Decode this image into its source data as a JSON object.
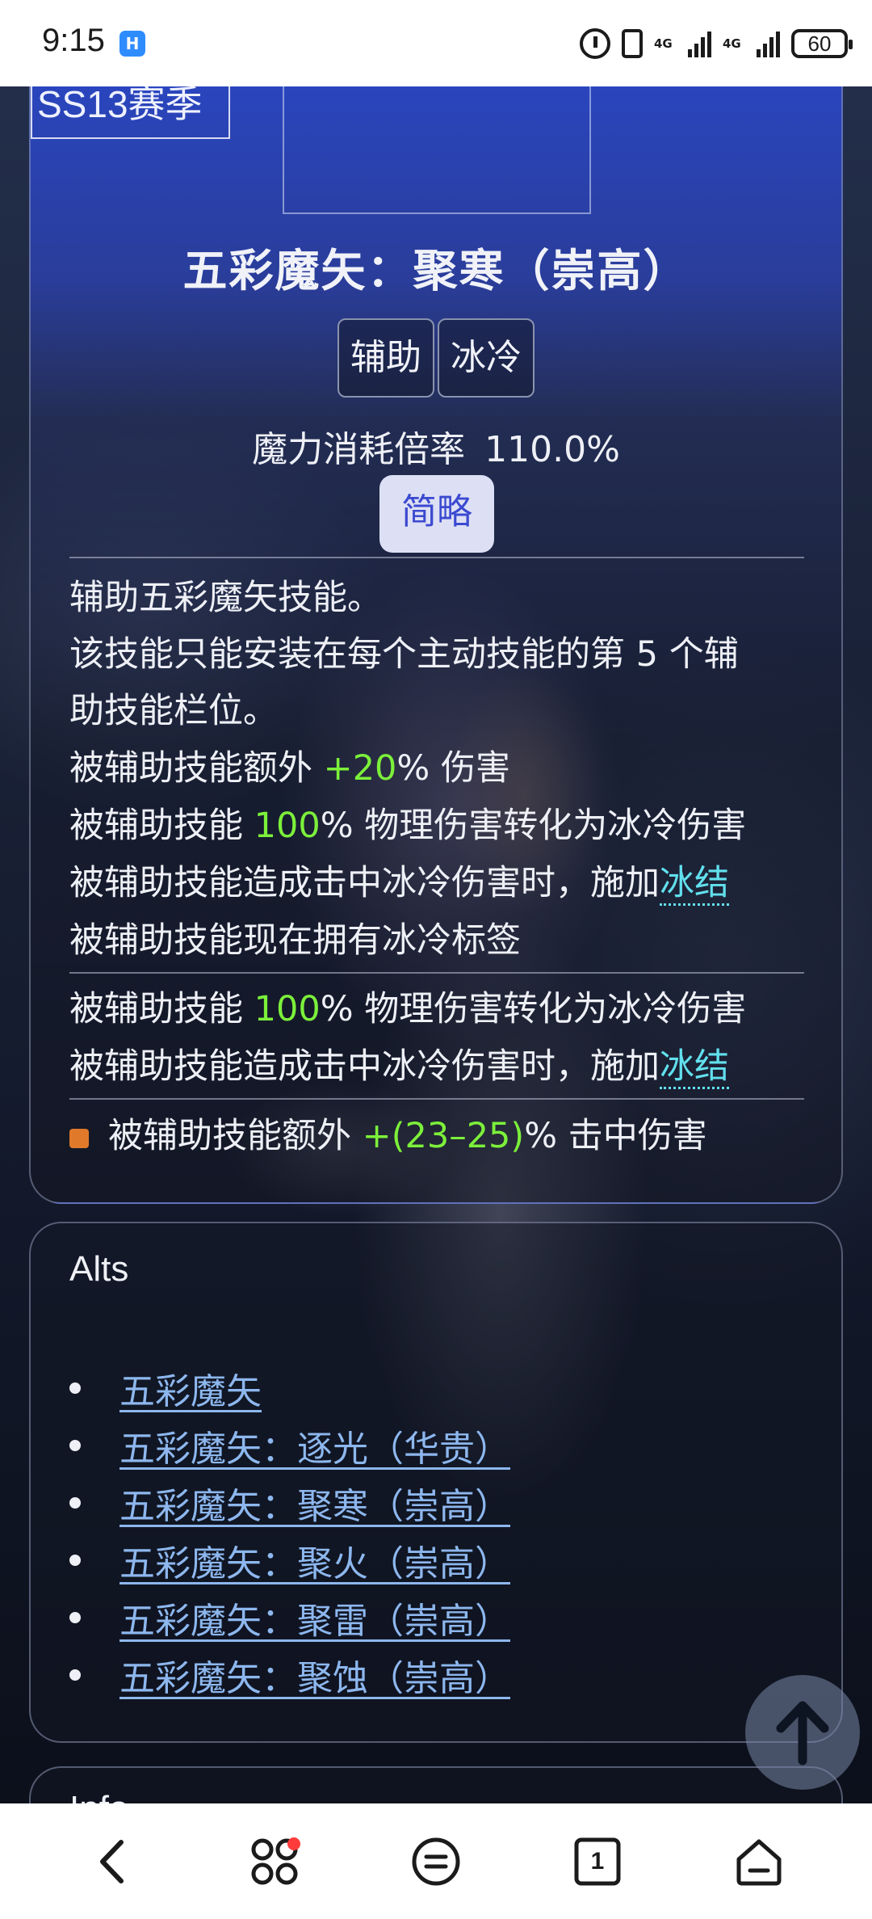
{
  "status_bar": {
    "time": "9:15",
    "app_icon_glyph": "H",
    "network_1": "4G",
    "network_2": "4G",
    "battery": "60"
  },
  "skill": {
    "season_tag": "SS13赛季",
    "title": "五彩魔矢：聚寒（崇高）",
    "tags": [
      "辅助",
      "冰冷"
    ],
    "mana_label": "魔力消耗倍率",
    "mana_value": "110.0%",
    "brief_button": "简略"
  },
  "description": {
    "line1": "辅助五彩魔矢技能。",
    "line2": "该技能只能安装在每个主动技能的第 5 个辅",
    "line3": "助技能栏位。",
    "line4_pre": "被辅助技能额外 ",
    "line4_val": "+20",
    "line4_post": "% 伤害",
    "line5_pre": "被辅助技能 ",
    "line5_val": "100",
    "line5_post": "% 物理伤害转化为冰冷伤害",
    "line6_pre": "被辅助技能造成击中冰冷伤害时，施加",
    "line6_link": "冰结",
    "line7": "被辅助技能现在拥有冰冷标签"
  },
  "quality": {
    "line1_pre": "被辅助技能 ",
    "line1_val": "100",
    "line1_post": "% 物理伤害转化为冰冷伤害",
    "line2_pre": "被辅助技能造成击中冰冷伤害时，施加",
    "line2_link": "冰结"
  },
  "modifier": {
    "pre": "被辅助技能额外 ",
    "val": "+(23–25)",
    "post": "% 击中伤害"
  },
  "alts": {
    "title": "Alts",
    "items": [
      "五彩魔矢",
      "五彩魔矢：逐光（华贵）",
      "五彩魔矢：聚寒（崇高）",
      "五彩魔矢：聚火（崇高）",
      "五彩魔矢：聚雷（崇高）",
      "五彩魔矢：聚蚀（崇高）"
    ]
  },
  "next_section": {
    "title": "Info"
  },
  "bottom_nav": {
    "tab_count": "1"
  },
  "colors": {
    "highlight_green": "#7cf03a",
    "link_cyan": "#62e0ee",
    "link_blue": "#8db7ee",
    "button_text": "#3b4ad0"
  },
  "icons": [
    "back-icon",
    "apps-icon",
    "menu-icon",
    "tabs-icon",
    "home-icon",
    "arrow-up-icon"
  ]
}
